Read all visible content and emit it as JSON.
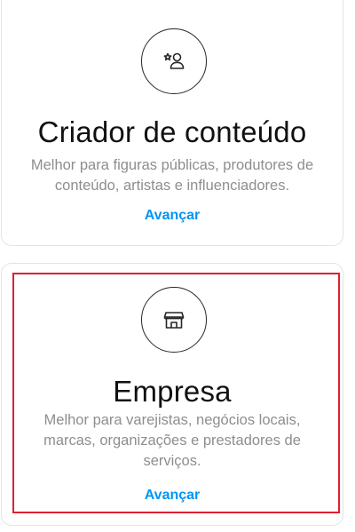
{
  "cards": [
    {
      "icon": "creator-star-person-icon",
      "title": "Criador de conteúdo",
      "description_lines": [
        "Melhor para figuras públicas, produtores de",
        "conteúdo, artistas e influenciadores."
      ],
      "action_label": "Avançar"
    },
    {
      "icon": "storefront-icon",
      "title": "Empresa",
      "description_lines": [
        "Melhor para varejistas, negócios locais,",
        "marcas, organizações e prestadores de",
        "serviços."
      ],
      "action_label": "Avançar"
    }
  ],
  "colors": {
    "link": "#0095f6",
    "highlight": "#e0202f",
    "text_secondary": "#8e8e8e"
  }
}
